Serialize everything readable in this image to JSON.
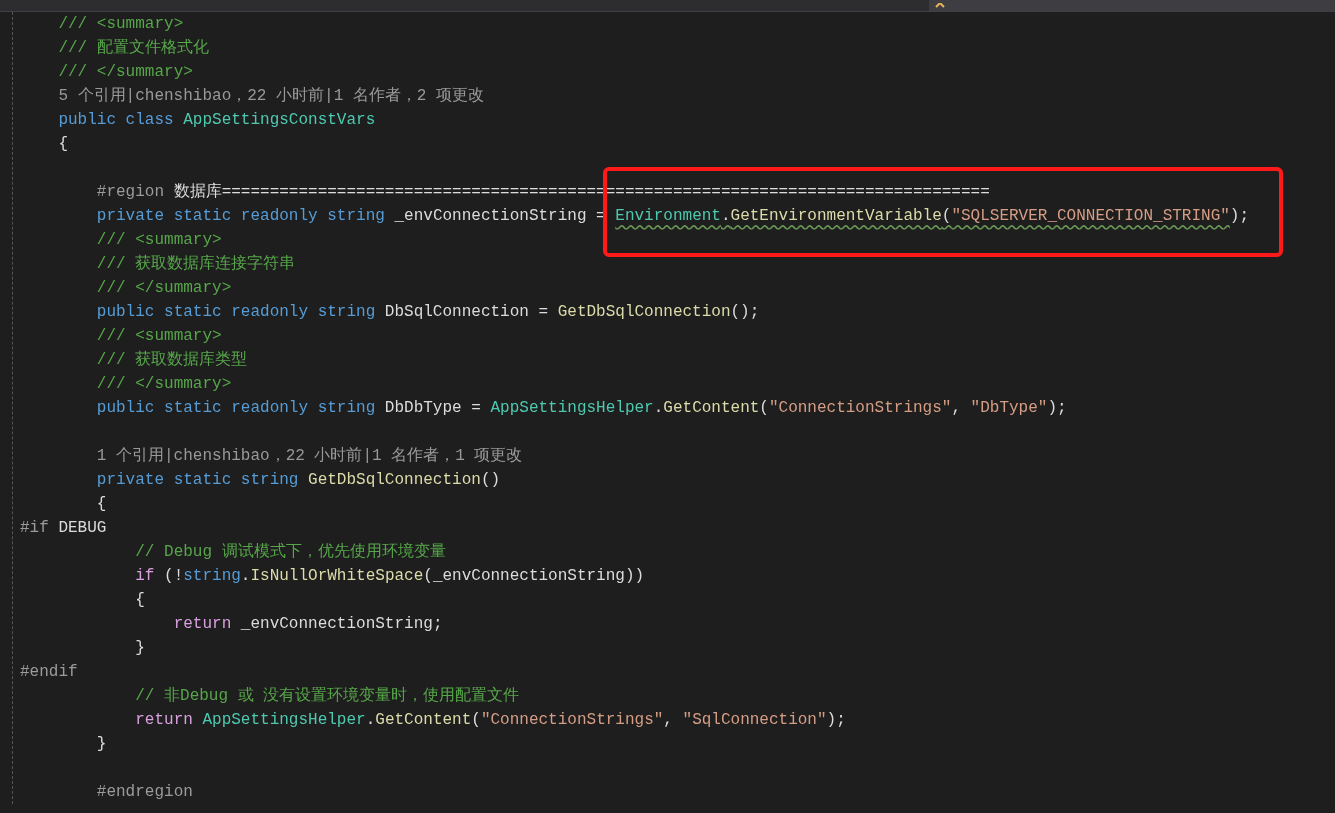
{
  "editor": {
    "lines": [
      {
        "kind": "block",
        "children": [
          {
            "kind": "code",
            "tokens": [
              {
                "kind": "comment",
                "text": "/// <summary>"
              }
            ]
          },
          {
            "kind": "code",
            "tokens": [
              {
                "kind": "comment",
                "text": "/// 配置文件格式化"
              }
            ]
          },
          {
            "kind": "code",
            "tokens": [
              {
                "kind": "comment",
                "text": "/// </summary>"
              }
            ]
          },
          {
            "kind": "lens",
            "tokens": [
              {
                "kind": "lens",
                "text": "5 个引用|chenshibao，22 小时前|1 名作者，2 项更改"
              }
            ]
          },
          {
            "kind": "code",
            "tokens": [
              {
                "kind": "keyword",
                "text": "public class "
              },
              {
                "kind": "type",
                "text": "AppSettingsConstVars"
              }
            ]
          },
          {
            "kind": "code",
            "tokens": [
              {
                "kind": "plain",
                "text": "{"
              }
            ]
          },
          {
            "kind": "blank"
          },
          {
            "kind": "block",
            "children": [
              {
                "kind": "code",
                "tokens": [
                  {
                    "kind": "preproc",
                    "text": "#region "
                  },
                  {
                    "kind": "plain",
                    "text": "数据库================================================================================"
                  }
                ]
              },
              {
                "kind": "code",
                "tokens": [
                  {
                    "kind": "keyword",
                    "text": "private static readonly string "
                  },
                  {
                    "kind": "plain",
                    "text": "_envConnectionString = "
                  },
                  {
                    "kind": "type",
                    "text": "Environment",
                    "squiggle": true
                  },
                  {
                    "kind": "plain",
                    "text": ".",
                    "squiggle": true
                  },
                  {
                    "kind": "method",
                    "text": "GetEnvironmentVariable",
                    "squiggle": true
                  },
                  {
                    "kind": "plain",
                    "text": "(",
                    "squiggle": true
                  },
                  {
                    "kind": "string",
                    "text": "\"SQLSERVER_CONNECTION_STRING\"",
                    "squiggle": true
                  },
                  {
                    "kind": "plain",
                    "text": ");"
                  }
                ]
              },
              {
                "kind": "code",
                "tokens": [
                  {
                    "kind": "comment",
                    "text": "/// <summary>"
                  }
                ]
              },
              {
                "kind": "code",
                "tokens": [
                  {
                    "kind": "comment",
                    "text": "/// 获取数据库连接字符串"
                  }
                ]
              },
              {
                "kind": "code",
                "tokens": [
                  {
                    "kind": "comment",
                    "text": "/// </summary>"
                  }
                ]
              },
              {
                "kind": "code",
                "tokens": [
                  {
                    "kind": "keyword",
                    "text": "public static readonly string "
                  },
                  {
                    "kind": "plain",
                    "text": "DbSqlConnection = "
                  },
                  {
                    "kind": "method",
                    "text": "GetDbSqlConnection"
                  },
                  {
                    "kind": "plain",
                    "text": "();"
                  }
                ]
              },
              {
                "kind": "code",
                "tokens": [
                  {
                    "kind": "comment",
                    "text": "/// <summary>"
                  }
                ]
              },
              {
                "kind": "code",
                "tokens": [
                  {
                    "kind": "comment",
                    "text": "/// 获取数据库类型"
                  }
                ]
              },
              {
                "kind": "code",
                "tokens": [
                  {
                    "kind": "comment",
                    "text": "/// </summary>"
                  }
                ]
              },
              {
                "kind": "code",
                "tokens": [
                  {
                    "kind": "keyword",
                    "text": "public static readonly string "
                  },
                  {
                    "kind": "plain",
                    "text": "DbDbType = "
                  },
                  {
                    "kind": "type",
                    "text": "AppSettingsHelper"
                  },
                  {
                    "kind": "plain",
                    "text": "."
                  },
                  {
                    "kind": "method",
                    "text": "GetContent"
                  },
                  {
                    "kind": "plain",
                    "text": "("
                  },
                  {
                    "kind": "string",
                    "text": "\"ConnectionStrings\""
                  },
                  {
                    "kind": "plain",
                    "text": ", "
                  },
                  {
                    "kind": "string",
                    "text": "\"DbType\""
                  },
                  {
                    "kind": "plain",
                    "text": ");"
                  }
                ]
              },
              {
                "kind": "blank"
              },
              {
                "kind": "lens",
                "tokens": [
                  {
                    "kind": "lens",
                    "text": "1 个引用|chenshibao，22 小时前|1 名作者，1 项更改"
                  }
                ]
              },
              {
                "kind": "code",
                "tokens": [
                  {
                    "kind": "keyword",
                    "text": "private static string "
                  },
                  {
                    "kind": "method",
                    "text": "GetDbSqlConnection"
                  },
                  {
                    "kind": "plain",
                    "text": "()"
                  }
                ]
              },
              {
                "kind": "code",
                "tokens": [
                  {
                    "kind": "plain",
                    "text": "{"
                  }
                ]
              }
            ]
          }
        ]
      },
      {
        "kind": "code",
        "tokens": [
          {
            "kind": "preproc",
            "text": "#if "
          },
          {
            "kind": "plain",
            "text": "DEBUG"
          }
        ]
      },
      {
        "kind": "block",
        "children": [
          {
            "kind": "block",
            "children": [
              {
                "kind": "block",
                "children": [
                  {
                    "kind": "code",
                    "tokens": [
                      {
                        "kind": "comment",
                        "text": "// Debug 调试模式下，优先使用环境变量"
                      }
                    ]
                  },
                  {
                    "kind": "code",
                    "tokens": [
                      {
                        "kind": "control",
                        "text": "if "
                      },
                      {
                        "kind": "plain",
                        "text": "(!"
                      },
                      {
                        "kind": "keyword",
                        "text": "string"
                      },
                      {
                        "kind": "plain",
                        "text": "."
                      },
                      {
                        "kind": "method",
                        "text": "IsNullOrWhiteSpace"
                      },
                      {
                        "kind": "plain",
                        "text": "(_envConnectionString))"
                      }
                    ]
                  },
                  {
                    "kind": "code",
                    "tokens": [
                      {
                        "kind": "plain",
                        "text": "{"
                      }
                    ]
                  },
                  {
                    "kind": "block",
                    "children": [
                      {
                        "kind": "code",
                        "tokens": [
                          {
                            "kind": "control",
                            "text": "return "
                          },
                          {
                            "kind": "plain",
                            "text": "_envConnectionString;"
                          }
                        ]
                      }
                    ]
                  },
                  {
                    "kind": "code",
                    "tokens": [
                      {
                        "kind": "plain",
                        "text": "}"
                      }
                    ]
                  }
                ]
              }
            ]
          }
        ]
      },
      {
        "kind": "code",
        "tokens": [
          {
            "kind": "preproc",
            "text": "#endif"
          }
        ]
      },
      {
        "kind": "block",
        "children": [
          {
            "kind": "block",
            "children": [
              {
                "kind": "block",
                "children": [
                  {
                    "kind": "code",
                    "tokens": [
                      {
                        "kind": "comment",
                        "text": "// 非Debug 或 没有设置环境变量时，使用配置文件"
                      }
                    ]
                  },
                  {
                    "kind": "code",
                    "tokens": [
                      {
                        "kind": "control",
                        "text": "return "
                      },
                      {
                        "kind": "type",
                        "text": "AppSettingsHelper"
                      },
                      {
                        "kind": "plain",
                        "text": "."
                      },
                      {
                        "kind": "method",
                        "text": "GetContent"
                      },
                      {
                        "kind": "plain",
                        "text": "("
                      },
                      {
                        "kind": "string",
                        "text": "\"ConnectionStrings\""
                      },
                      {
                        "kind": "plain",
                        "text": ", "
                      },
                      {
                        "kind": "string",
                        "text": "\"SqlConnection\""
                      },
                      {
                        "kind": "plain",
                        "text": ");"
                      }
                    ]
                  }
                ]
              },
              {
                "kind": "code",
                "tokens": [
                  {
                    "kind": "plain",
                    "text": "}"
                  }
                ]
              },
              {
                "kind": "blank"
              },
              {
                "kind": "code",
                "tokens": [
                  {
                    "kind": "preproc",
                    "text": "#endregion"
                  }
                ]
              }
            ]
          }
        ]
      }
    ]
  }
}
